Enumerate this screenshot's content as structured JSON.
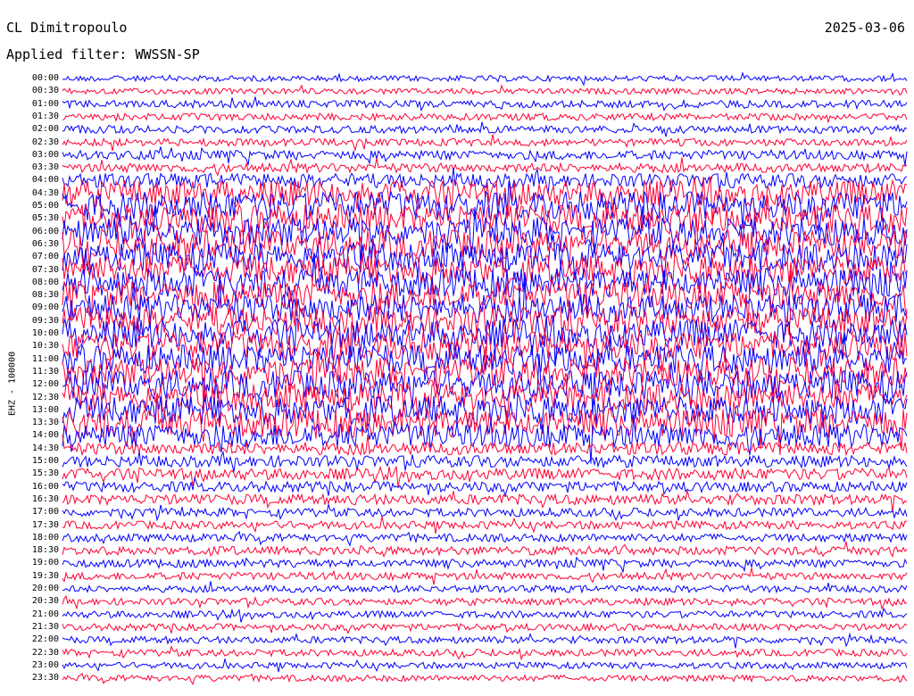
{
  "header": {
    "station": "CL Dimitropoulo",
    "filter": "Applied filter: WWSSN-SP",
    "date": "2025-03-06",
    "channel": "EHZ - 100000"
  },
  "colors": {
    "even": "#0000ff",
    "odd": "#ff0033"
  },
  "chart_data": {
    "type": "line",
    "title": "CL Dimitropoulo",
    "subtitle": "Applied filter: WWSSN-SP",
    "date": "2025-03-06",
    "ylabel": "EHZ - 100000",
    "hour_labels": [
      "00:00",
      "00:30",
      "01:00",
      "01:30",
      "02:00",
      "02:30",
      "03:00",
      "03:30",
      "04:00",
      "04:30",
      "05:00",
      "05:30",
      "06:00",
      "06:30",
      "07:00",
      "07:30",
      "08:00",
      "08:30",
      "09:00",
      "09:30",
      "10:00",
      "10:30",
      "11:00",
      "11:30",
      "12:00",
      "12:30",
      "13:00",
      "13:30",
      "14:00",
      "14:30",
      "15:00",
      "15:30",
      "16:00",
      "16:30",
      "17:00",
      "17:30",
      "18:00",
      "18:30",
      "19:00",
      "19:30",
      "20:00",
      "20:30",
      "21:00",
      "21:30",
      "22:00",
      "22:30",
      "23:00",
      "23:30"
    ],
    "trace_colors": [
      "blue",
      "red"
    ],
    "relative_amplitude": [
      1,
      1,
      1.3,
      1.2,
      1.3,
      1.3,
      1.6,
      1.6,
      2.5,
      4.5,
      5,
      5,
      5,
      5,
      5,
      5,
      5,
      5,
      5,
      5,
      5,
      5,
      5,
      5,
      5,
      5,
      5,
      5,
      4.2,
      2.2,
      2.0,
      2.0,
      1.8,
      1.8,
      1.5,
      1.4,
      1.4,
      1.5,
      1.4,
      1.3,
      1.2,
      1.2,
      1.2,
      1.2,
      1.2,
      1.2,
      1.1,
      1.1
    ]
  }
}
